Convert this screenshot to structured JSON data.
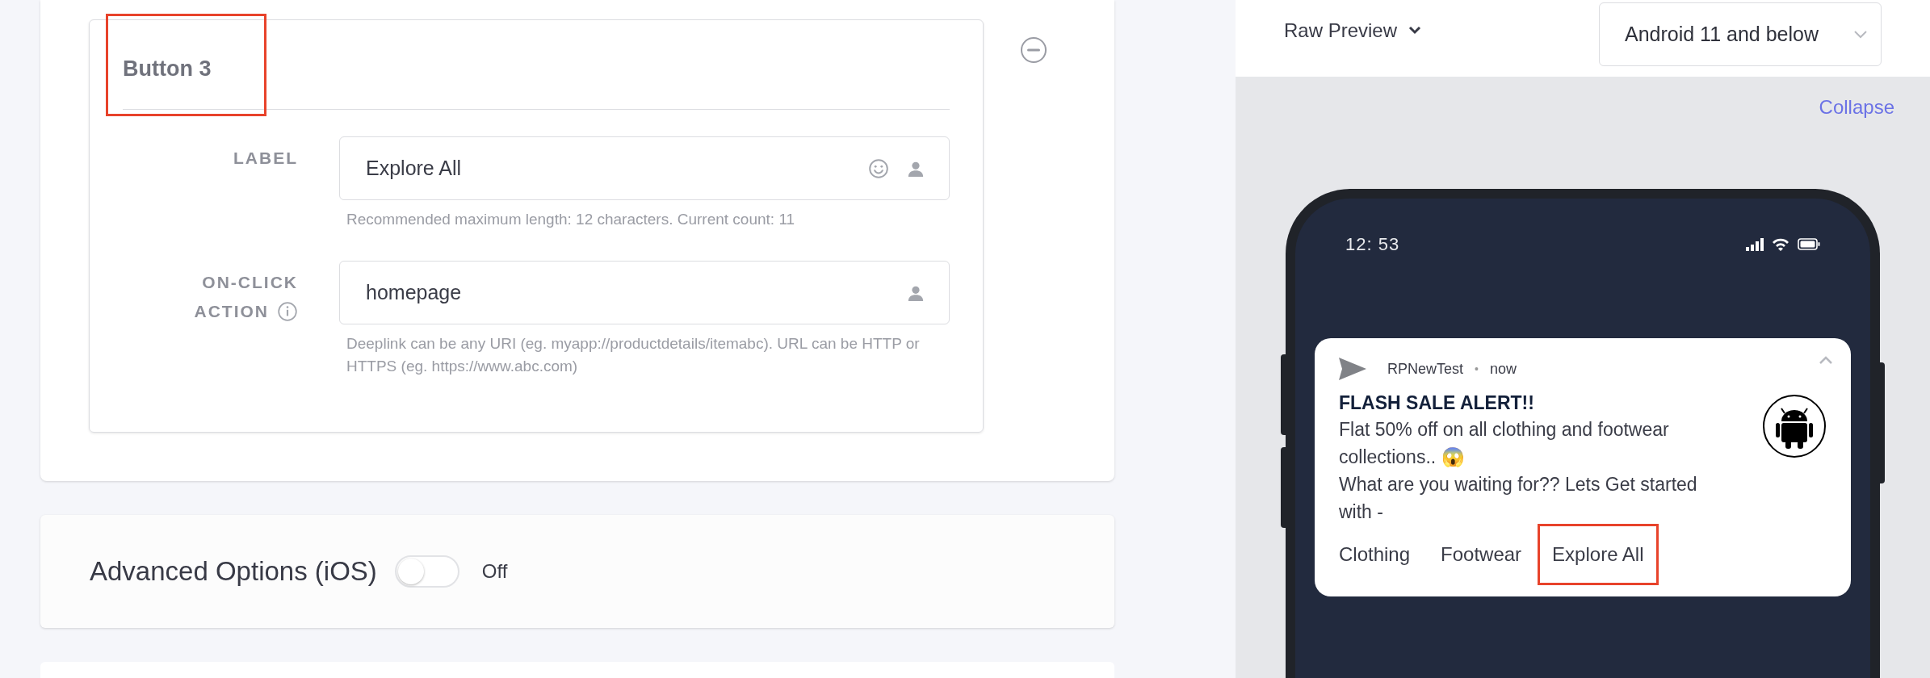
{
  "button_editor": {
    "title": "Button 3",
    "highlighted": true,
    "fields": [
      {
        "label": "LABEL",
        "value": "Explore All",
        "emoji_picker": true,
        "hint": "Recommended maximum length: 12 characters. Current count: 11"
      },
      {
        "label": "ON-CLICK",
        "label_line2": "ACTION",
        "info": true,
        "value": "homepage",
        "emoji_picker": false,
        "hint": "Deeplink can be any URI (eg. myapp://productdetails/itemabc). URL can be HTTP or HTTPS (eg. https://www.abc.com)"
      }
    ]
  },
  "advanced_options": {
    "title": "Advanced Options (iOS)",
    "on": false,
    "state_text": "Off"
  },
  "preview": {
    "mode": "Raw Preview",
    "platform": "Android 11 and below",
    "collapse": "Collapse",
    "phone": {
      "time": "12: 53"
    },
    "notification": {
      "app": "RPNewTest",
      "separator": "•",
      "time": "now",
      "title": "FLASH SALE ALERT!!",
      "body": [
        "Flat 50% off on all clothing and footwear collections.. 😱",
        "What are you waiting for?? Lets Get started with -"
      ],
      "actions": [
        {
          "label": "Clothing",
          "highlighted": false
        },
        {
          "label": "Footwear",
          "highlighted": false
        },
        {
          "label": "Explore All",
          "highlighted": true
        }
      ]
    }
  }
}
